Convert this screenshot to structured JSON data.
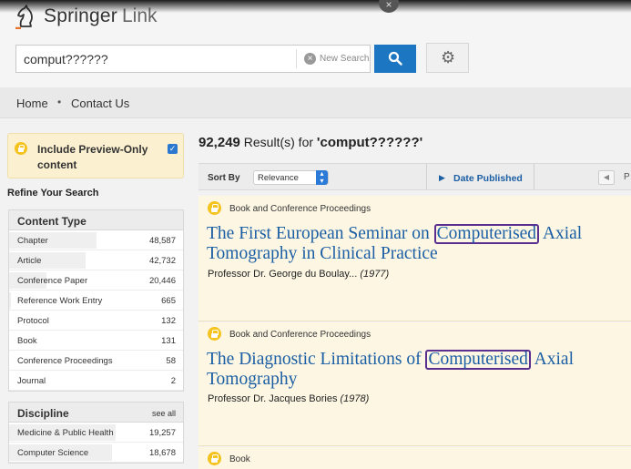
{
  "header": {
    "logo_primary": "Springer",
    "logo_secondary": "Link",
    "search": {
      "value": "comput??????",
      "new_search_label": "New Search"
    }
  },
  "nav": {
    "home": "Home",
    "contact": "Contact Us"
  },
  "sidebar": {
    "preview_only_label": "Include Preview-Only content",
    "preview_only_checked": true,
    "refine_heading": "Refine Your Search",
    "content_type": {
      "title": "Content Type",
      "items": [
        {
          "label": "Chapter",
          "count": "48,587",
          "share": 0.49
        },
        {
          "label": "Article",
          "count": "42,732",
          "share": 0.43
        },
        {
          "label": "Conference Paper",
          "count": "20,446",
          "share": 0.21
        },
        {
          "label": "Reference Work Entry",
          "count": "665",
          "share": 0.01
        },
        {
          "label": "Protocol",
          "count": "132",
          "share": 0.0
        },
        {
          "label": "Book",
          "count": "131",
          "share": 0.0
        },
        {
          "label": "Conference Proceedings",
          "count": "58",
          "share": 0.0
        },
        {
          "label": "Journal",
          "count": "2",
          "share": 0.0
        }
      ]
    },
    "discipline": {
      "title": "Discipline",
      "see_all": "see all",
      "items": [
        {
          "label": "Medicine & Public Health",
          "count": "19,257",
          "share": 0.6
        },
        {
          "label": "Computer Science",
          "count": "18,678",
          "share": 0.58
        }
      ]
    }
  },
  "results": {
    "count": "92,249",
    "summary_suffix": "Result(s) for",
    "query": "'comput??????'",
    "sort": {
      "label": "Sort By",
      "selected": "Relevance",
      "date_published": "Date Published",
      "page_text": "P"
    },
    "items": [
      {
        "type": "Book and Conference Proceedings",
        "title_before": "The First European Seminar on ",
        "title_highlight": "Computerised",
        "title_after": " Axial Tomography in Clinical Practice",
        "author": "Professor Dr. George du Boulay...",
        "year": "(1977)"
      },
      {
        "type": "Book and Conference Proceedings",
        "title_before": "The Diagnostic Limitations of ",
        "title_highlight": "Computerised",
        "title_after": " Axial Tomography",
        "author": "Professor Dr. Jacques Bories",
        "year": "(1978)"
      },
      {
        "type": "Book"
      }
    ]
  }
}
